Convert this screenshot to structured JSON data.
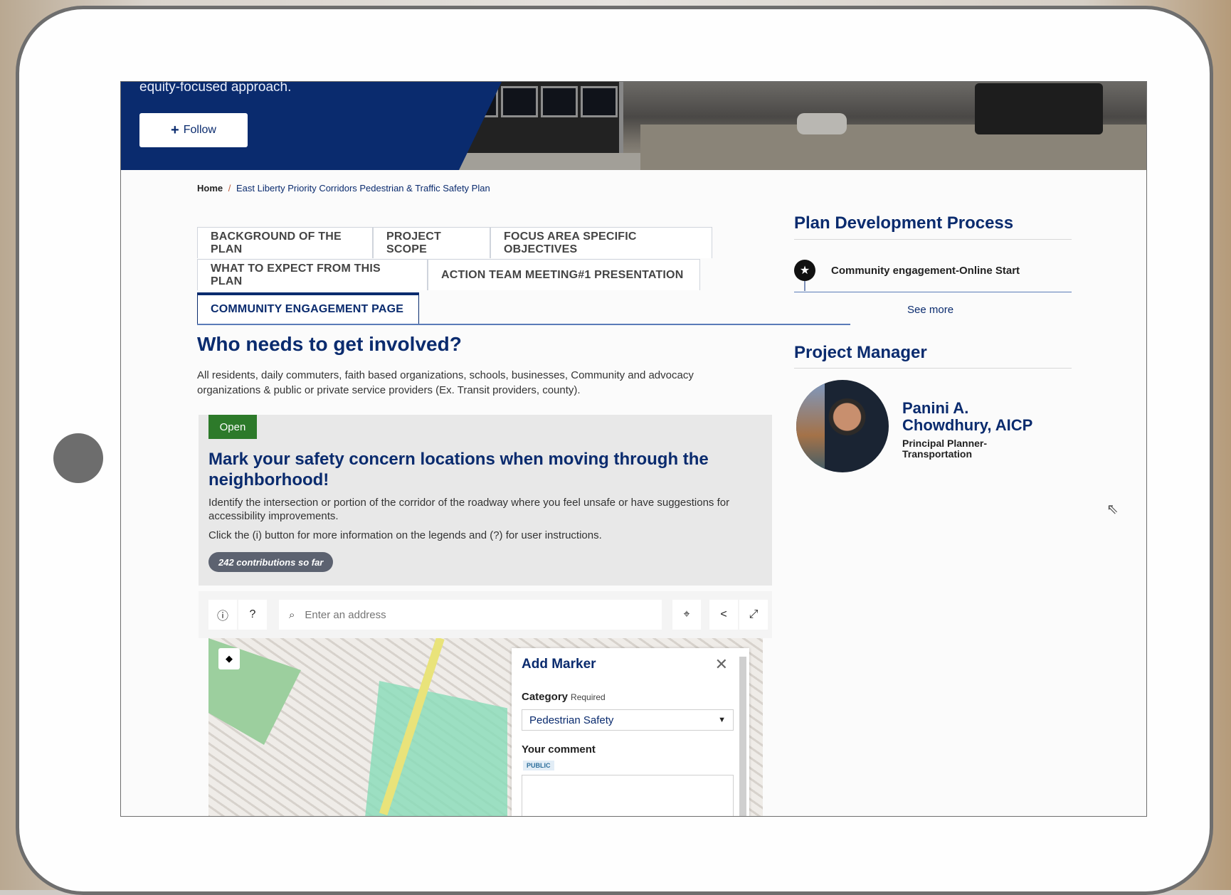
{
  "hero": {
    "intro_text": "equity-focused approach.",
    "follow_label": "Follow"
  },
  "breadcrumb": {
    "home": "Home",
    "separator": "/",
    "current": "East Liberty Priority Corridors Pedestrian & Traffic Safety Plan"
  },
  "tabs": [
    {
      "label": "BACKGROUND OF THE PLAN",
      "active": false
    },
    {
      "label": "PROJECT SCOPE",
      "active": false
    },
    {
      "label": "FOCUS AREA SPECIFIC OBJECTIVES",
      "active": false
    },
    {
      "label": "WHAT TO EXPECT FROM THIS PLAN",
      "active": false
    },
    {
      "label": "ACTION TEAM MEETING#1 PRESENTATION",
      "active": false
    },
    {
      "label": "COMMUNITY ENGAGEMENT PAGE",
      "active": true
    }
  ],
  "main": {
    "heading": "Who needs to get involved?",
    "description": "All residents, daily commuters, faith based organizations, schools, businesses, Community and advocacy organizations & public or private service providers (Ex. Transit providers, county)."
  },
  "engagement": {
    "status": "Open",
    "title": "Mark your safety concern locations when moving through the neighborhood!",
    "instructions": "Identify the intersection or portion of the corridor of the roadway where you feel unsafe or have suggestions for accessibility improvements.",
    "help_text": "Click the (i) button for more information on the legends and (?) for user instructions.",
    "contributions": "242 contributions so far"
  },
  "map_toolbar": {
    "info_icon": "info-icon",
    "help_icon": "question-icon",
    "search_placeholder": "Enter an address",
    "locate_icon": "crosshair-icon",
    "share_icon": "share-icon",
    "fullscreen_icon": "expand-icon"
  },
  "marker_panel": {
    "title": "Add Marker",
    "category_label": "Category",
    "required_label": "Required",
    "category_value": "Pedestrian Safety",
    "comment_label": "Your comment",
    "public_badge": "PUBLIC"
  },
  "sidebar": {
    "plan_heading": "Plan Development Process",
    "timeline_item": "Community engagement-Online Start",
    "see_more": "See more",
    "manager_heading": "Project Manager",
    "manager_name": "Panini A. Chowdhury, AICP",
    "manager_title": "Principal Planner-Transportation"
  },
  "colors": {
    "brand_navy": "#0a2b6e",
    "open_green": "#2d7a2a",
    "device_frame": "#6e6e6e"
  }
}
